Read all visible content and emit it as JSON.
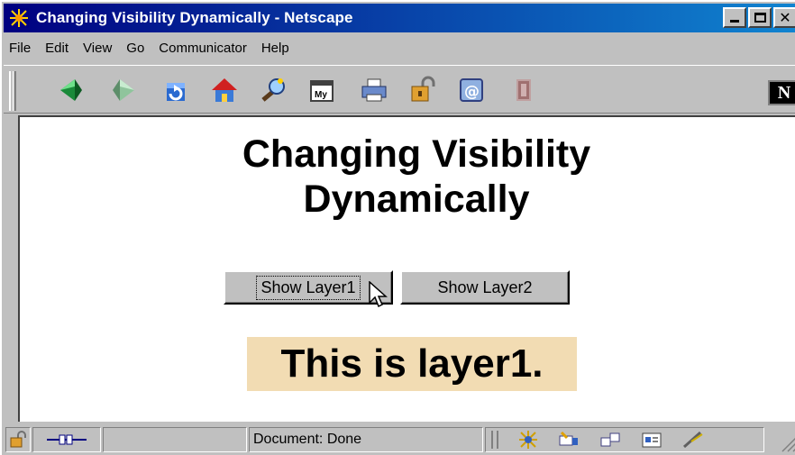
{
  "window": {
    "title": "Changing Visibility Dynamically - Netscape"
  },
  "menu": {
    "items": [
      {
        "label": "File"
      },
      {
        "label": "Edit"
      },
      {
        "label": "View"
      },
      {
        "label": "Go"
      },
      {
        "label": "Communicator"
      },
      {
        "label": "Help"
      }
    ]
  },
  "toolbar": {
    "icons": [
      "back-icon",
      "forward-icon",
      "reload-icon",
      "home-icon",
      "search-icon",
      "my-netscape-icon",
      "print-icon",
      "security-icon",
      "shop-icon",
      "stop-icon"
    ],
    "logo": "N"
  },
  "page": {
    "heading_line1": "Changing Visibility",
    "heading_line2": "Dynamically",
    "button1_label": "Show Layer1",
    "button2_label": "Show Layer2",
    "layer_text": "This is layer1.",
    "layer_color": "#f2dcb3"
  },
  "status": {
    "text": "Document: Done"
  }
}
